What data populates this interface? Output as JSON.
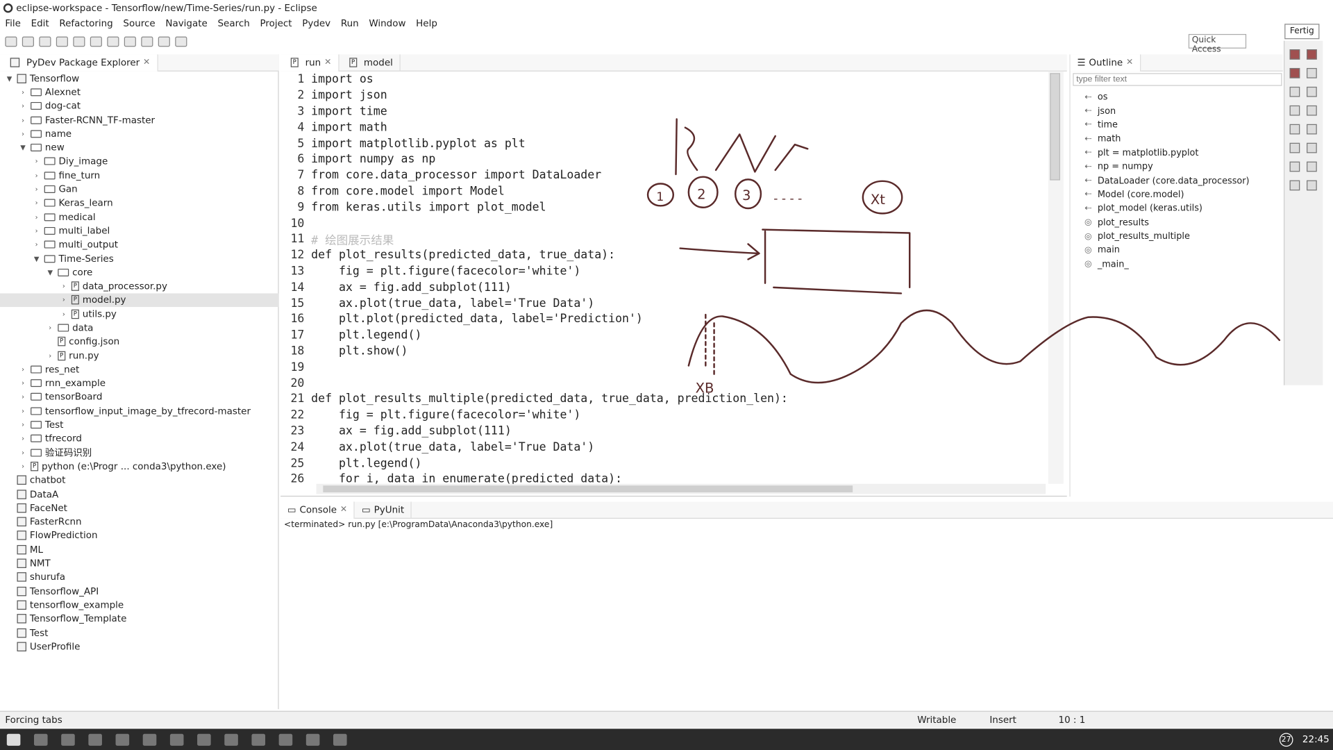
{
  "window": {
    "title": "eclipse-workspace - Tensorflow/new/Time-Series/run.py - Eclipse"
  },
  "menu": [
    "File",
    "Edit",
    "Refactoring",
    "Source",
    "Navigate",
    "Search",
    "Project",
    "Pydev",
    "Run",
    "Window",
    "Help"
  ],
  "quick_access": "Quick Access",
  "fertig": "Fertig",
  "explorer": {
    "title": "PyDev Package Explorer"
  },
  "tree": [
    {
      "label": "Tensorflow",
      "depth": 0,
      "arrow": "▼",
      "kind": "proj"
    },
    {
      "label": "Alexnet",
      "depth": 1,
      "arrow": "›",
      "kind": "folder"
    },
    {
      "label": "dog-cat",
      "depth": 1,
      "arrow": "›",
      "kind": "folder"
    },
    {
      "label": "Faster-RCNN_TF-master",
      "depth": 1,
      "arrow": "›",
      "kind": "folder"
    },
    {
      "label": "name",
      "depth": 1,
      "arrow": "›",
      "kind": "folder"
    },
    {
      "label": "new",
      "depth": 1,
      "arrow": "▼",
      "kind": "folder"
    },
    {
      "label": "Diy_image",
      "depth": 2,
      "arrow": "›",
      "kind": "folder"
    },
    {
      "label": "fine_turn",
      "depth": 2,
      "arrow": "›",
      "kind": "folder"
    },
    {
      "label": "Gan",
      "depth": 2,
      "arrow": "›",
      "kind": "folder"
    },
    {
      "label": "Keras_learn",
      "depth": 2,
      "arrow": "›",
      "kind": "folder"
    },
    {
      "label": "medical",
      "depth": 2,
      "arrow": "›",
      "kind": "folder"
    },
    {
      "label": "multi_label",
      "depth": 2,
      "arrow": "›",
      "kind": "folder"
    },
    {
      "label": "multi_output",
      "depth": 2,
      "arrow": "›",
      "kind": "folder"
    },
    {
      "label": "Time-Series",
      "depth": 2,
      "arrow": "▼",
      "kind": "folder"
    },
    {
      "label": "core",
      "depth": 3,
      "arrow": "▼",
      "kind": "folder"
    },
    {
      "label": "data_processor.py",
      "depth": 4,
      "arrow": "›",
      "kind": "file"
    },
    {
      "label": "model.py",
      "depth": 4,
      "arrow": "›",
      "kind": "file",
      "selected": true
    },
    {
      "label": "utils.py",
      "depth": 4,
      "arrow": "›",
      "kind": "file"
    },
    {
      "label": "data",
      "depth": 3,
      "arrow": "›",
      "kind": "folder"
    },
    {
      "label": "config.json",
      "depth": 3,
      "arrow": "",
      "kind": "file"
    },
    {
      "label": "run.py",
      "depth": 3,
      "arrow": "›",
      "kind": "file"
    },
    {
      "label": "res_net",
      "depth": 1,
      "arrow": "›",
      "kind": "folder"
    },
    {
      "label": "rnn_example",
      "depth": 1,
      "arrow": "›",
      "kind": "folder"
    },
    {
      "label": "tensorBoard",
      "depth": 1,
      "arrow": "›",
      "kind": "folder"
    },
    {
      "label": "tensorflow_input_image_by_tfrecord-master",
      "depth": 1,
      "arrow": "›",
      "kind": "folder"
    },
    {
      "label": "Test",
      "depth": 1,
      "arrow": "›",
      "kind": "folder"
    },
    {
      "label": "tfrecord",
      "depth": 1,
      "arrow": "›",
      "kind": "folder"
    },
    {
      "label": "验证码识别",
      "depth": 1,
      "arrow": "›",
      "kind": "folder"
    },
    {
      "label": "python  (e:\\Progr ... conda3\\python.exe)",
      "depth": 1,
      "arrow": "›",
      "kind": "file"
    },
    {
      "label": "chatbot",
      "depth": 0,
      "arrow": "",
      "kind": "proj"
    },
    {
      "label": "DataA",
      "depth": 0,
      "arrow": "",
      "kind": "proj"
    },
    {
      "label": "FaceNet",
      "depth": 0,
      "arrow": "",
      "kind": "proj"
    },
    {
      "label": "FasterRcnn",
      "depth": 0,
      "arrow": "",
      "kind": "proj"
    },
    {
      "label": "FlowPrediction",
      "depth": 0,
      "arrow": "",
      "kind": "proj"
    },
    {
      "label": "ML",
      "depth": 0,
      "arrow": "",
      "kind": "proj"
    },
    {
      "label": "NMT",
      "depth": 0,
      "arrow": "",
      "kind": "proj"
    },
    {
      "label": "shurufa",
      "depth": 0,
      "arrow": "",
      "kind": "proj"
    },
    {
      "label": "Tensorflow_API",
      "depth": 0,
      "arrow": "",
      "kind": "proj"
    },
    {
      "label": "tensorflow_example",
      "depth": 0,
      "arrow": "",
      "kind": "proj"
    },
    {
      "label": "Tensorflow_Template",
      "depth": 0,
      "arrow": "",
      "kind": "proj"
    },
    {
      "label": "Test",
      "depth": 0,
      "arrow": "",
      "kind": "proj"
    },
    {
      "label": "UserProfile",
      "depth": 0,
      "arrow": "",
      "kind": "proj"
    }
  ],
  "editor_tabs": [
    {
      "label": "run",
      "active": true
    },
    {
      "label": "model",
      "active": false
    }
  ],
  "code": [
    "import os",
    "import json",
    "import time",
    "import math",
    "import matplotlib.pyplot as plt",
    "import numpy as np",
    "from core.data_processor import DataLoader",
    "from core.model import Model",
    "from keras.utils import plot_model",
    "",
    "# 绘图展示结果",
    "def plot_results(predicted_data, true_data):",
    "    fig = plt.figure(facecolor='white')",
    "    ax = fig.add_subplot(111)",
    "    ax.plot(true_data, label='True Data')",
    "    plt.plot(predicted_data, label='Prediction')",
    "    plt.legend()",
    "    plt.show()",
    "",
    "",
    "def plot_results_multiple(predicted_data, true_data, prediction_len):",
    "    fig = plt.figure(facecolor='white')",
    "    ax = fig.add_subplot(111)",
    "    ax.plot(true_data, label='True Data')",
    "    plt.legend()",
    "    for i, data in enumerate(predicted_data):"
  ],
  "outline": {
    "title": "Outline",
    "filter_placeholder": "type filter text",
    "items": [
      "os",
      "json",
      "time",
      "math",
      "plt = matplotlib.pyplot",
      "np = numpy",
      "DataLoader (core.data_processor)",
      "Model (core.model)",
      "plot_model (keras.utils)",
      "plot_results",
      "plot_results_multiple",
      "main",
      "_main_"
    ]
  },
  "console": {
    "tabs": [
      "Console",
      "PyUnit"
    ],
    "status": "<terminated> run.py [e:\\ProgramData\\Anaconda3\\python.exe]"
  },
  "status": {
    "left": "Forcing tabs",
    "writable": "Writable",
    "insert": "Insert",
    "pos": "10 : 1"
  },
  "clock": {
    "time": "22:45",
    "badge": "27"
  },
  "ink_text": {
    "RNN": "RNN",
    "n1": "1",
    "n2": "2",
    "n3": "3",
    "dots": "- - - -",
    "xt": "Xt",
    "xb": "XB"
  }
}
